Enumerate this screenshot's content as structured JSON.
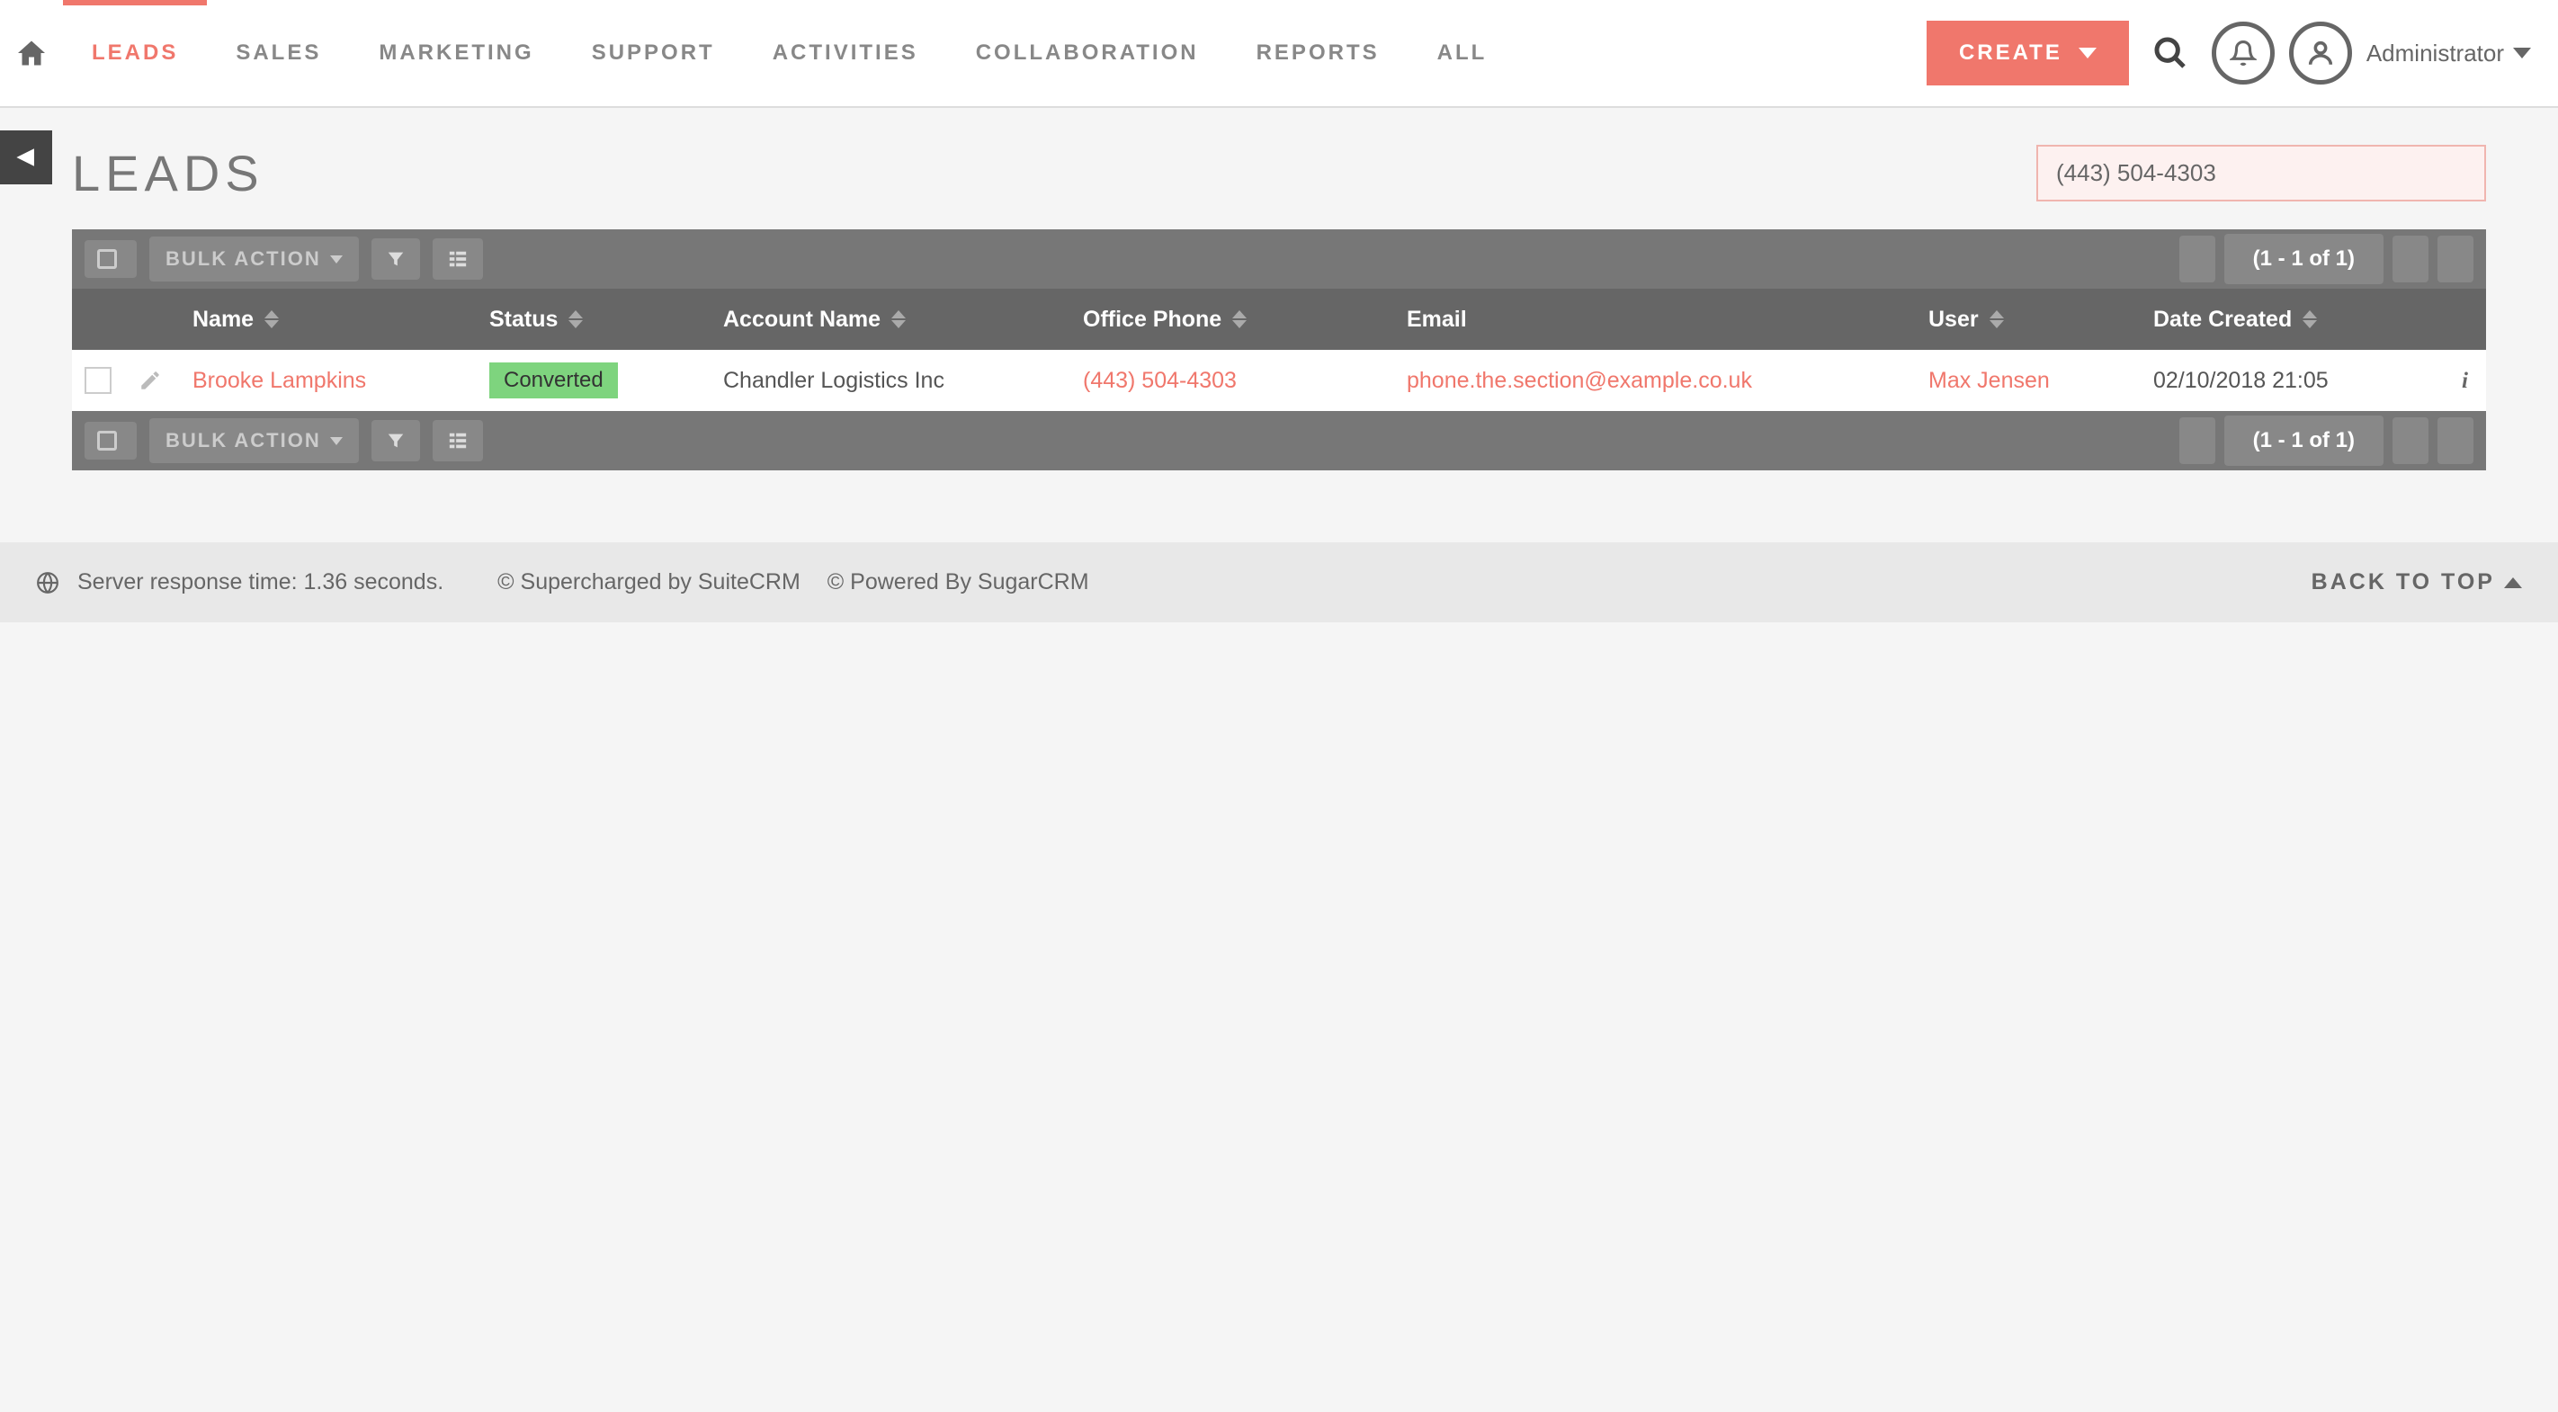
{
  "nav": {
    "tabs": [
      "LEADS",
      "SALES",
      "MARKETING",
      "SUPPORT",
      "ACTIVITIES",
      "COLLABORATION",
      "REPORTS",
      "ALL"
    ],
    "active_index": 0,
    "create_label": "CREATE",
    "admin_label": "Administrator"
  },
  "page": {
    "title": "LEADS",
    "search_value": "(443) 504-4303"
  },
  "toolbar": {
    "bulk_action_label": "BULK ACTION",
    "pagination_info": "(1 - 1 of 1)"
  },
  "table": {
    "headers": {
      "name": "Name",
      "status": "Status",
      "account": "Account Name",
      "phone": "Office Phone",
      "email": "Email",
      "user": "User",
      "date": "Date Created"
    },
    "rows": [
      {
        "name": "Brooke Lampkins",
        "status": "Converted",
        "account": "Chandler Logistics Inc",
        "phone": "(443) 504-4303",
        "email": "phone.the.section@example.co.uk",
        "user": "Max Jensen",
        "date": "02/10/2018 21:05"
      }
    ]
  },
  "footer": {
    "response_time": "Server response time: 1.36 seconds.",
    "supercharged": "© Supercharged by SuiteCRM",
    "powered": "© Powered By SugarCRM",
    "back_top": "BACK TO TOP"
  }
}
